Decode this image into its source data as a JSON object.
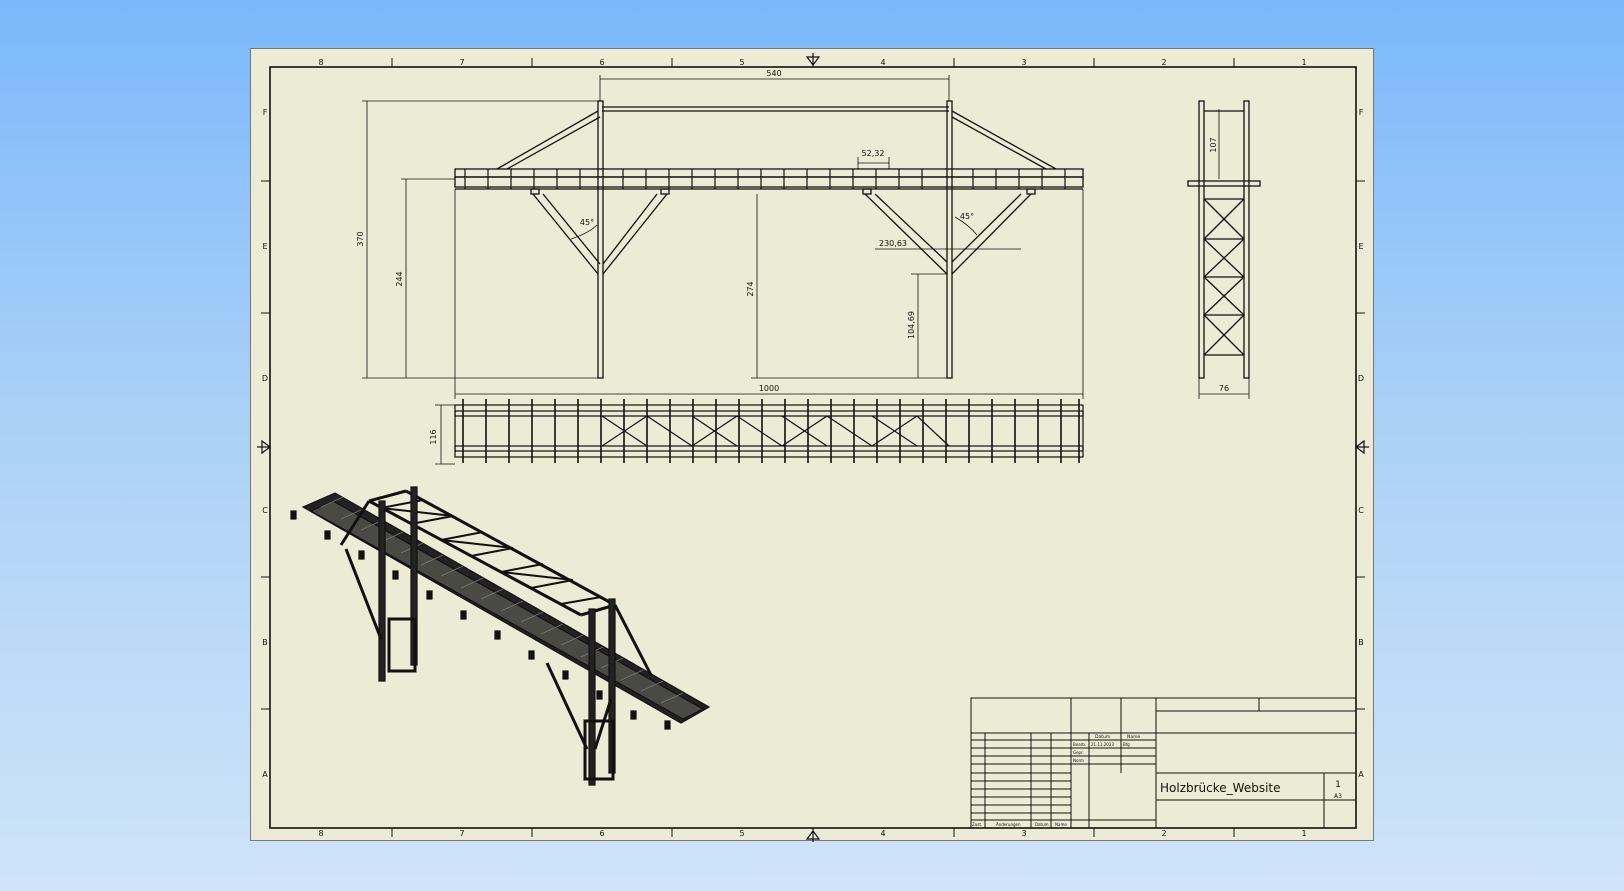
{
  "border_zones": {
    "columns": [
      "8",
      "7",
      "6",
      "5",
      "4",
      "3",
      "2",
      "1"
    ],
    "rows": [
      "F",
      "E",
      "D",
      "C",
      "B",
      "A"
    ]
  },
  "dimensions": {
    "top_span": "540",
    "overall_height": "370",
    "deck_height": "244",
    "pier_height": "274",
    "total_length": "1000",
    "post_spacing": "52,32",
    "angle_left": "45°",
    "angle_right": "45°",
    "strut_span": "230,63",
    "strut_height": "104,69",
    "side_height": "107",
    "side_width": "76",
    "plan_width": "116"
  },
  "title_block": {
    "drawing_title": "Holzbrücke_Website",
    "sheet_number": "1",
    "sheet_size": "A3",
    "col_date": "Datum",
    "col_name": "Name",
    "row_drawn": "Bearb.",
    "row_checked": "Gepr.",
    "row_norm": "Norm",
    "date_value": "21.11.2023",
    "name_value": "Bfg",
    "footer_status": "Zust.",
    "footer_changes": "Änderungen",
    "footer_date": "Datum",
    "footer_name": "Name"
  }
}
